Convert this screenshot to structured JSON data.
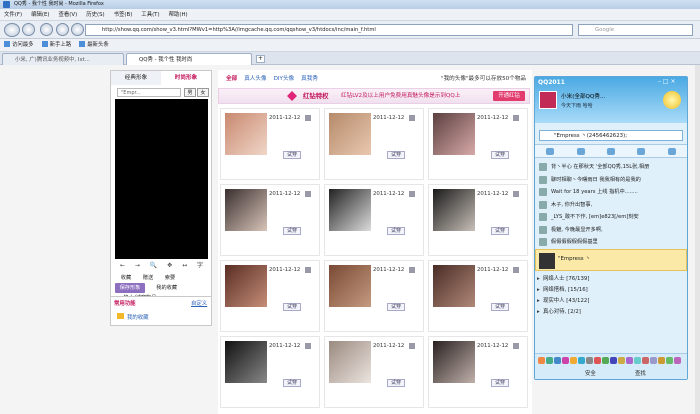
{
  "window": {
    "title": "QQ秀 - 我个性 我时尚 - Mozilla Firefox"
  },
  "menu": [
    "文件(F)",
    "编辑(E)",
    "查看(V)",
    "历史(S)",
    "书签(B)",
    "工具(T)",
    "帮助(H)"
  ],
  "nav": {
    "url": "http://show.qq.com/show_v3.html?MWv1=http%3A//imgcache.qq.com/qqshow_v3/htdocs/inc/main_f.html",
    "search_placeholder": "Google"
  },
  "bookmarks": [
    "访问最多",
    "新手上路",
    "最新头条"
  ],
  "tabs": [
    {
      "label": "小米, 广)腾讯业务视频中, Ixt..."
    },
    {
      "label": "QQ秀 - 我个性 我时尚"
    }
  ],
  "panel": {
    "tab1": "经典形象",
    "tab2": "时尚形象",
    "input": "\"Empr...",
    "btn_male": "男",
    "btn_female": "女",
    "tools": [
      "←",
      "→",
      "🔍",
      "✥",
      "↔",
      "字"
    ],
    "acts": [
      "收藏",
      "赠送",
      "索要",
      "保存形象",
      "我的收藏",
      "换上/试穿物品"
    ],
    "func_title": "常用功能",
    "func_link": "自定义",
    "func_item": "我的收藏"
  },
  "main": {
    "cats": [
      "全部",
      "真人头像",
      "DIY头像",
      "真我秀"
    ],
    "note": "\"我的头像\"最多可以存放50个物品",
    "banner_title": "红钻特权",
    "banner_text": "红钻LV2及以上用户免费用真魅头像是示到QQ上",
    "banner_btn": "开通红钻",
    "cells": [
      {
        "date": "2011-12-12",
        "try": "试穿",
        "c1": "#c98970",
        "c2": "#f0d6c8"
      },
      {
        "date": "2011-12-12",
        "try": "试穿",
        "c1": "#b58a6a",
        "c2": "#e9c8b0"
      },
      {
        "date": "2011-12-12",
        "try": "试穿",
        "c1": "#5c3f40",
        "c2": "#d7aaa8"
      },
      {
        "date": "2011-12-12",
        "try": "试穿",
        "c1": "#3a3030",
        "c2": "#d8c4b8"
      },
      {
        "date": "2011-12-12",
        "try": "试穿",
        "c1": "#222",
        "c2": "#dcdcdc"
      },
      {
        "date": "2011-12-12",
        "try": "试穿",
        "c1": "#1a1a1a",
        "c2": "#c8c0b8"
      },
      {
        "date": "2011-12-12",
        "try": "试穿",
        "c1": "#5a2e24",
        "c2": "#c58d78"
      },
      {
        "date": "2011-12-12",
        "try": "试穿",
        "c1": "#7a4a34",
        "c2": "#c49a80"
      },
      {
        "date": "2011-12-12",
        "try": "试穿",
        "c1": "#4a2c26",
        "c2": "#b08878"
      },
      {
        "date": "2011-12-12",
        "try": "试穿",
        "c1": "#111",
        "c2": "#888"
      },
      {
        "date": "2011-12-12",
        "try": "试穿",
        "c1": "#9a8a80",
        "c2": "#ece4df"
      },
      {
        "date": "2011-12-12",
        "try": "试穿",
        "c1": "#2a2222",
        "c2": "#c0b0aa"
      }
    ]
  },
  "qq": {
    "title": "QQ2011",
    "name": "小米(全部QQ秀...",
    "sig": "今天下雨 哈哈",
    "search": "\"Empress 丶(2456462623);",
    "contacts": [
      "背丶半心  在那秋天 '全部QQ秀,15L张,相册",
      "聊时相聊丶今曙雨日  我我相有的是我的",
      "Wait for 18 years  上线 指机中........",
      "木子,  你升出智事,",
      "_LYS_敢不下作, [em]e823[/em]刻安",
      "极魅, 今晚最显开多啊,",
      "假假假假假假假基里"
    ],
    "active": "\"Empress 丶",
    "groups": [
      "网络人士  [76/139]",
      "网络搭档,  [15/16]",
      "现实中人  [43/122]",
      "真心对待,  [2/2]"
    ],
    "bottom_items": [
      "安全",
      "查找"
    ]
  },
  "colors": {
    "accent": "#c2185b",
    "qq": "#4aa9e3"
  }
}
